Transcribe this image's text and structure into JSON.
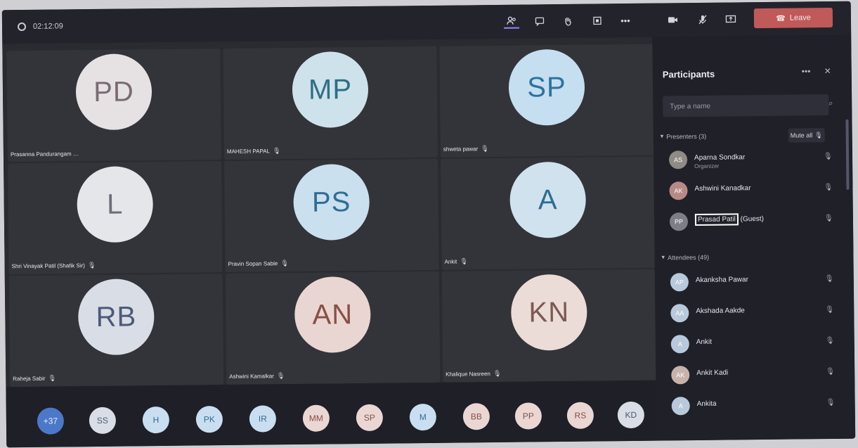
{
  "meeting": {
    "timer": "02:12:09",
    "leave_label": "Leave",
    "toolbar": [
      "participants-icon",
      "chat-icon",
      "raise-hand-icon",
      "rooms-icon",
      "more-icon",
      "camera-icon",
      "mic-icon",
      "share-icon"
    ]
  },
  "tiles": [
    {
      "initials": "PD",
      "name": "Prasanna Pandurangam …",
      "bg": "#e6e1e3",
      "fg": "#7b6b72"
    },
    {
      "initials": "MP",
      "name": "MAHESH PAPAL",
      "bg": "#cde2ea",
      "fg": "#2e6f86"
    },
    {
      "initials": "SP",
      "name": "shweta pawar",
      "bg": "#c6dff0",
      "fg": "#2c73a0"
    },
    {
      "initials": "L",
      "name": "Shri Vinayak Patil (Shafik Sir)",
      "bg": "#e4e6ea",
      "fg": "#6b6f78"
    },
    {
      "initials": "PS",
      "name": "Pravin Sopan Sable",
      "bg": "#cbe0ef",
      "fg": "#2f6f94"
    },
    {
      "initials": "A",
      "name": "Ankit",
      "bg": "#cfe2ee",
      "fg": "#2d6d90"
    },
    {
      "initials": "RB",
      "name": "Raheja Sabir",
      "bg": "#d8dde6",
      "fg": "#4a5a78"
    },
    {
      "initials": "AN",
      "name": "Ashwini Kamalkar",
      "bg": "#e9d6d2",
      "fg": "#8a4f44"
    },
    {
      "initials": "KN",
      "name": "Khalique Nasreen",
      "bg": "#ecdcd8",
      "fg": "#7c5a52"
    }
  ],
  "strip": [
    {
      "label": "+37",
      "bg": "#4b78c8",
      "fg": "#e8efff"
    },
    {
      "label": "SS",
      "bg": "#d9dde6",
      "fg": "#4a5a78"
    },
    {
      "label": "H",
      "bg": "#c9def0",
      "fg": "#2f6f94"
    },
    {
      "label": "PK",
      "bg": "#c9def0",
      "fg": "#2f6f94"
    },
    {
      "label": "IR",
      "bg": "#c9def0",
      "fg": "#2f6f94"
    },
    {
      "label": "MM",
      "bg": "#ead6d3",
      "fg": "#8a4f44"
    },
    {
      "label": "SP",
      "bg": "#ead6d3",
      "fg": "#8a4f44"
    },
    {
      "label": "M",
      "bg": "#c9def0",
      "fg": "#2f6f94"
    },
    {
      "label": "BB",
      "bg": "#ead6d3",
      "fg": "#8a4f44"
    },
    {
      "label": "PP",
      "bg": "#ead6d3",
      "fg": "#8a4f44"
    },
    {
      "label": "RS",
      "bg": "#ead6d3",
      "fg": "#8a4f44"
    },
    {
      "label": "KD",
      "bg": "#d9dde6",
      "fg": "#4a5a78"
    }
  ],
  "panel": {
    "title": "Participants",
    "search_placeholder": "Type a name",
    "presenters_header": "Presenters (3)",
    "mute_all_label": "Mute all",
    "attendees_header": "Attendees (49)",
    "presenters": [
      {
        "name": "Aparna Sondkar",
        "role": "Organizer",
        "initials": "AS",
        "bg": "#8f8a84"
      },
      {
        "name": "Ashwini Kanadkar",
        "role": "",
        "initials": "AK",
        "bg": "#b78a86"
      },
      {
        "name": "Prasad Patil",
        "suffix": "(Guest)",
        "role": "",
        "initials": "PP",
        "bg": "#7d7f86"
      }
    ],
    "attendees": [
      {
        "name": "Akanksha Pawar",
        "initials": "AP",
        "bg": "#b7c9da"
      },
      {
        "name": "Akshada Aakde",
        "initials": "AA",
        "bg": "#b7c9da"
      },
      {
        "name": "Ankit",
        "initials": "A",
        "bg": "#b7c9da"
      },
      {
        "name": "Ankit Kadi",
        "initials": "AK",
        "bg": "#c7b3ac"
      },
      {
        "name": "Ankita",
        "initials": "A",
        "bg": "#b7c9da"
      }
    ]
  }
}
